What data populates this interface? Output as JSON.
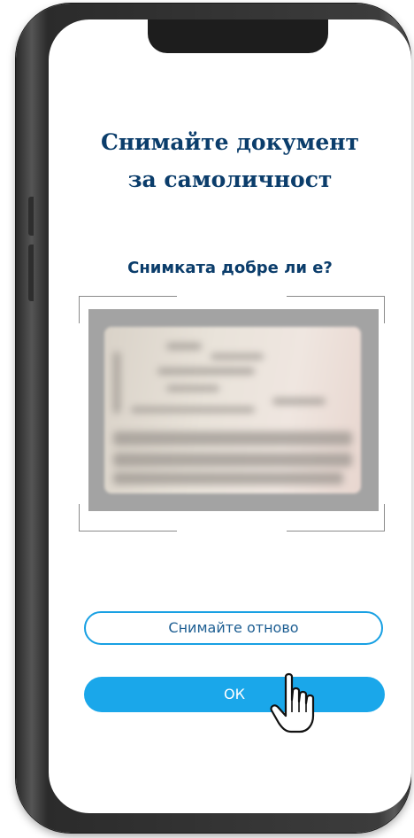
{
  "screen": {
    "title_line1": "Снимайте документ",
    "title_line2": "за самоличност",
    "question": "Снимката добре ли е?"
  },
  "buttons": {
    "retake_label": "Снимайте отново",
    "ok_label": "ОК"
  },
  "icons": {
    "cursor": "hand-pointer-icon"
  },
  "colors": {
    "title": "#0b3d6b",
    "accent": "#1aa7ea",
    "photo_background": "#a3a3a3"
  }
}
